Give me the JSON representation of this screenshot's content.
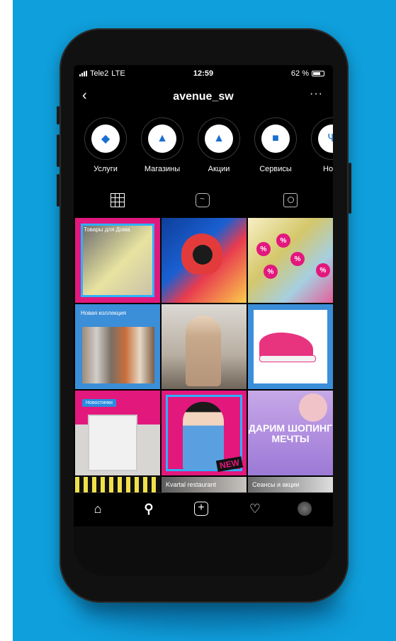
{
  "colors": {
    "background": "#0f9fdc",
    "accent_pink": "#e2187d",
    "accent_blue": "#2db1ff"
  },
  "status_bar": {
    "carrier": "Tele2",
    "network": "LTE",
    "time": "12:59",
    "battery": "62 %"
  },
  "header": {
    "username": "avenue_sw",
    "back_icon": "chevron-left-icon",
    "more_icon": "more-icon"
  },
  "stories": [
    {
      "label": "Услуги",
      "icon": "tag-icon"
    },
    {
      "label": "Магазины",
      "icon": "glasses-icon"
    },
    {
      "label": "Акции",
      "icon": "dress-icon"
    },
    {
      "label": "Сервисы",
      "icon": "briefcase-icon"
    },
    {
      "label": "Ново",
      "icon": "food-icon"
    }
  ],
  "tabs": [
    {
      "icon": "grid-icon"
    },
    {
      "icon": "igtv-icon"
    },
    {
      "icon": "tagged-icon"
    }
  ],
  "posts": {
    "p1_caption": "Товары для Дома",
    "p4_caption": "Новая коллекция",
    "p7_badge": "Новостинки",
    "p8_sticker": "NEW",
    "p9_text": "ДАРИМ ШОПИНГ МЕЧТЫ",
    "strip2_caption": "Kvartal restaurant",
    "strip3_caption": "Сеансы и акции"
  },
  "bottom_nav": [
    {
      "icon": "home-icon"
    },
    {
      "icon": "search-icon"
    },
    {
      "icon": "add-post-icon"
    },
    {
      "icon": "heart-icon"
    },
    {
      "icon": "profile-avatar-icon"
    }
  ]
}
